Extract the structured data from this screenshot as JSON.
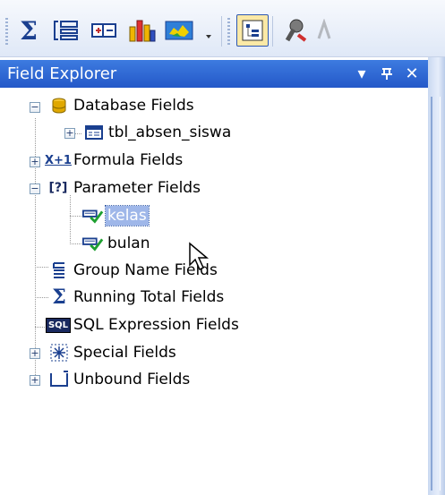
{
  "toolbar": {
    "buttons": [
      {
        "name": "summary-icon",
        "glyph": "Σ"
      },
      {
        "name": "group-icon"
      },
      {
        "name": "hierarchy-icon"
      },
      {
        "name": "chart-icon"
      },
      {
        "name": "map-icon"
      },
      {
        "name": "overflow-icon"
      },
      {
        "name": "field-explorer-icon"
      },
      {
        "name": "wrench-icon"
      }
    ]
  },
  "panel": {
    "title": "Field Explorer",
    "controls": {
      "dropdown": "▾",
      "pin": "ᵽ",
      "close": "✕"
    }
  },
  "tree": {
    "database_fields": {
      "label": "Database Fields",
      "expander": "−",
      "children": [
        {
          "label": "tbl_absen_siswa",
          "expander": "+"
        }
      ]
    },
    "formula_fields": {
      "label": "Formula Fields",
      "expander": "+",
      "icon_text": "X+1"
    },
    "parameter_fields": {
      "label": "Parameter Fields",
      "expander": "−",
      "icon_text": "[?]",
      "children": [
        {
          "label": "kelas",
          "selected": true
        },
        {
          "label": "bulan",
          "selected": false
        }
      ]
    },
    "group_name_fields": {
      "label": "Group Name Fields"
    },
    "running_total_fields": {
      "label": "Running Total Fields",
      "icon_text": "Σ"
    },
    "sql_expression_fields": {
      "label": "SQL Expression Fields",
      "icon_text": "SQL"
    },
    "special_fields": {
      "label": "Special Fields",
      "expander": "+"
    },
    "unbound_fields": {
      "label": "Unbound Fields",
      "expander": "+"
    }
  },
  "colors": {
    "titlebar": "#2a62d0",
    "selection": "#9fb7e9",
    "toolbar": "#e8eef9"
  }
}
